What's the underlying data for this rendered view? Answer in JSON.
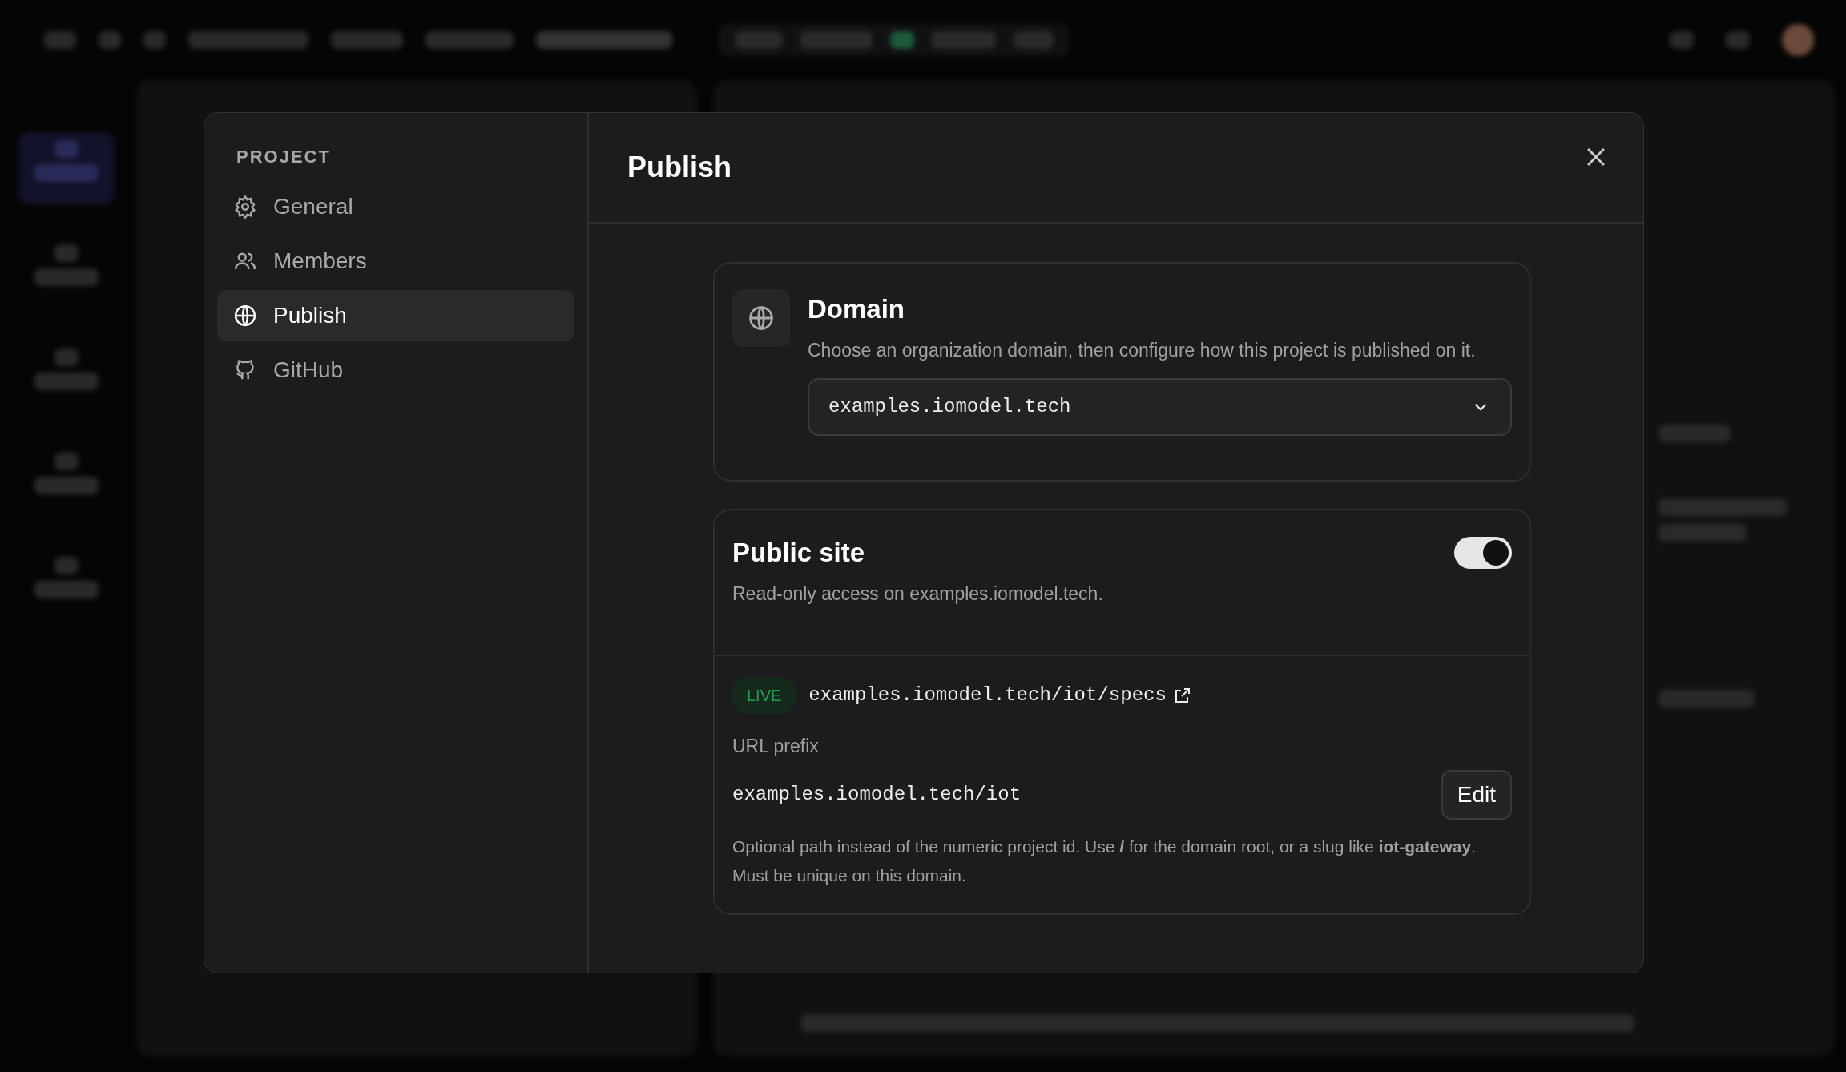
{
  "dialog": {
    "nav_heading": "PROJECT",
    "nav_items": [
      {
        "label": "General",
        "selected": false
      },
      {
        "label": "Members",
        "selected": false
      },
      {
        "label": "Publish",
        "selected": true
      },
      {
        "label": "GitHub",
        "selected": false
      }
    ],
    "title": "Publish",
    "domain": {
      "title": "Domain",
      "description": "Choose an organization domain, then configure how this project is published on it.",
      "value": "examples.iomodel.tech"
    },
    "public_site": {
      "title": "Public site",
      "on": true,
      "description": "Read-only access on examples.iomodel.tech.",
      "status": "LIVE",
      "url": "examples.iomodel.tech/iot/specs",
      "prefix_label": "URL prefix",
      "prefix": "examples.iomodel.tech/iot",
      "edit": "Edit",
      "help": "Optional path instead of the numeric project id. Use **/** for the domain root, or a slug like **iot-gateway**. Must be unique on this domain."
    }
  }
}
